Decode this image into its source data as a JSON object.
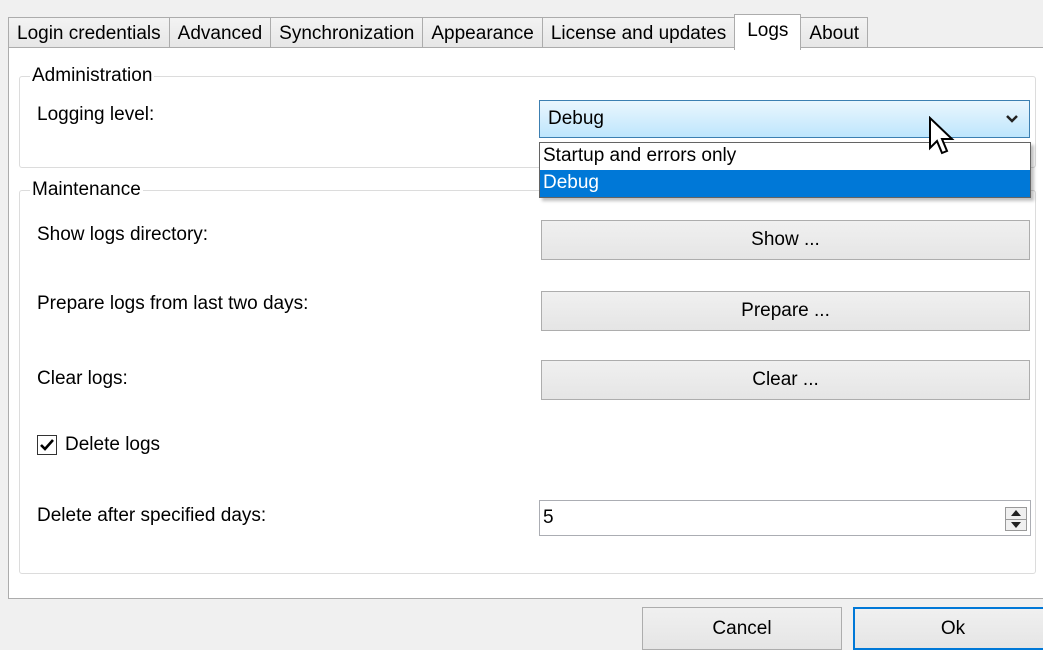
{
  "tabs": [
    "Login credentials",
    "Advanced",
    "Synchronization",
    "Appearance",
    "License and updates",
    "Logs",
    "About"
  ],
  "active_tab": "Logs",
  "administration": {
    "title": "Administration",
    "logging_level_label": "Logging level:",
    "logging_level_value": "Debug",
    "options": [
      "Startup and errors only",
      "Debug"
    ],
    "selected_option": "Debug"
  },
  "maintenance": {
    "title": "Maintenance",
    "show_label": "Show logs directory:",
    "show_button": "Show ...",
    "prepare_label": "Prepare logs from last two days:",
    "prepare_button": "Prepare ...",
    "clear_label": "Clear logs:",
    "clear_button": "Clear ...",
    "delete_logs_label": "Delete logs",
    "delete_logs_checked": true,
    "delete_after_label": "Delete after specified days:",
    "delete_after_value": "5"
  },
  "footer": {
    "cancel": "Cancel",
    "ok": "Ok"
  },
  "colors": {
    "selection": "#0078d7",
    "combo_border": "#3c7fb1"
  }
}
